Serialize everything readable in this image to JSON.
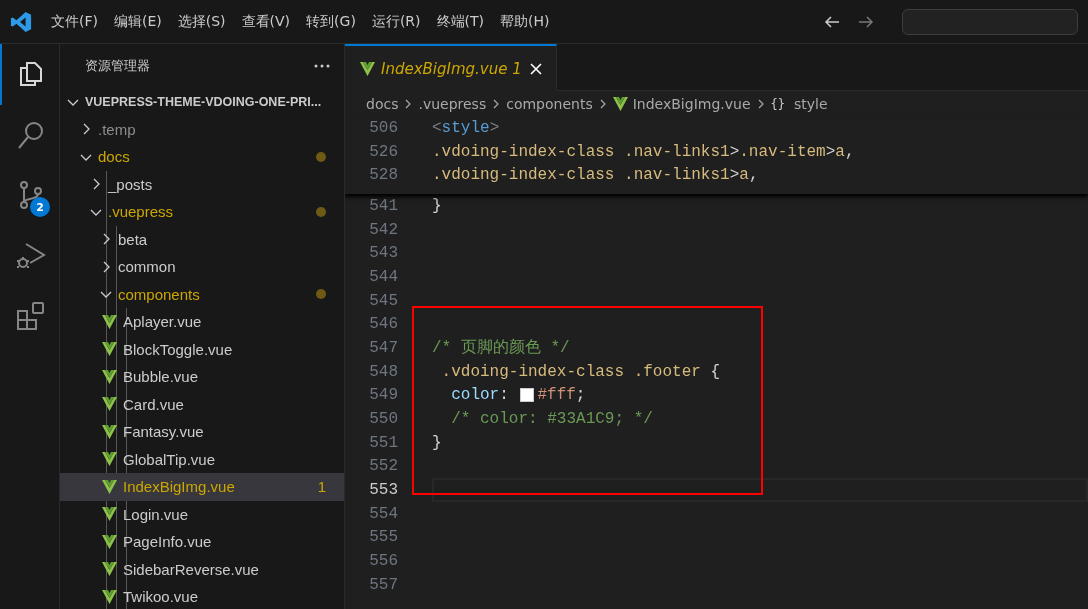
{
  "title_bar": {
    "menu": [
      "文件(F)",
      "编辑(E)",
      "选择(S)",
      "查看(V)",
      "转到(G)",
      "运行(R)",
      "终端(T)",
      "帮助(H)"
    ]
  },
  "activity_bar": [
    {
      "kind": "explorer",
      "selected": true
    },
    {
      "kind": "search",
      "selected": false
    },
    {
      "kind": "source-control",
      "selected": false,
      "badge": "2"
    },
    {
      "kind": "run-debug",
      "selected": false
    },
    {
      "kind": "extensions",
      "selected": false
    }
  ],
  "sidebar": {
    "title": "资源管理器",
    "root": {
      "label": "VUEPRESS-THEME-VDOING-ONE-PRI...",
      "expanded": true,
      "children": [
        {
          "label": ".temp",
          "kind": "folder",
          "expanded": false,
          "ignored": true,
          "modified": false,
          "selected": false
        },
        {
          "label": "docs",
          "kind": "folder",
          "expanded": true,
          "ignored": false,
          "modified": true,
          "selected": false,
          "children": [
            {
              "label": "_posts",
              "kind": "folder",
              "expanded": false,
              "ignored": false,
              "modified": false,
              "selected": false
            },
            {
              "label": ".vuepress",
              "kind": "folder",
              "expanded": true,
              "ignored": false,
              "modified": true,
              "selected": false,
              "children": [
                {
                  "label": "beta",
                  "kind": "folder",
                  "expanded": false,
                  "ignored": false,
                  "modified": false,
                  "selected": false
                },
                {
                  "label": "common",
                  "kind": "folder",
                  "expanded": false,
                  "ignored": false,
                  "modified": false,
                  "selected": false
                },
                {
                  "label": "components",
                  "kind": "folder",
                  "expanded": true,
                  "ignored": false,
                  "modified": true,
                  "selected": false,
                  "children": [
                    {
                      "label": "Aplayer.vue",
                      "kind": "vue",
                      "ignored": false,
                      "modified": false,
                      "selected": false
                    },
                    {
                      "label": "BlockToggle.vue",
                      "kind": "vue",
                      "ignored": false,
                      "modified": false,
                      "selected": false
                    },
                    {
                      "label": "Bubble.vue",
                      "kind": "vue",
                      "ignored": false,
                      "modified": false,
                      "selected": false
                    },
                    {
                      "label": "Card.vue",
                      "kind": "vue",
                      "ignored": false,
                      "modified": false,
                      "selected": false
                    },
                    {
                      "label": "Fantasy.vue",
                      "kind": "vue",
                      "ignored": false,
                      "modified": false,
                      "selected": false
                    },
                    {
                      "label": "GlobalTip.vue",
                      "kind": "vue",
                      "ignored": false,
                      "modified": false,
                      "selected": false
                    },
                    {
                      "label": "IndexBigImg.vue",
                      "kind": "vue",
                      "ignored": false,
                      "modified": true,
                      "selected": true,
                      "problems": "1"
                    },
                    {
                      "label": "Login.vue",
                      "kind": "vue",
                      "ignored": false,
                      "modified": false,
                      "selected": false
                    },
                    {
                      "label": "PageInfo.vue",
                      "kind": "vue",
                      "ignored": false,
                      "modified": false,
                      "selected": false
                    },
                    {
                      "label": "SidebarReverse.vue",
                      "kind": "vue",
                      "ignored": false,
                      "modified": false,
                      "selected": false
                    },
                    {
                      "label": "Twikoo.vue",
                      "kind": "vue",
                      "ignored": false,
                      "modified": false,
                      "selected": false
                    }
                  ]
                }
              ]
            }
          ]
        }
      ]
    }
  },
  "tabs": [
    {
      "label": "IndexBigImg.vue",
      "problems": "1",
      "selected": true,
      "preview": true
    }
  ],
  "breadcrumbs": [
    {
      "label": "docs",
      "kind": "folder"
    },
    {
      "label": ".vuepress",
      "kind": "folder"
    },
    {
      "label": "components",
      "kind": "folder"
    },
    {
      "label": "IndexBigImg.vue",
      "kind": "vue"
    },
    {
      "label": "style",
      "kind": "symbol",
      "icon": "{}"
    }
  ],
  "sticky_lines": [
    {
      "number": "506",
      "tokens": [
        {
          "kind": "punct",
          "text": "<"
        },
        {
          "kind": "tag",
          "text": "style"
        },
        {
          "kind": "punct",
          "text": ">"
        }
      ]
    },
    {
      "number": "526",
      "tokens": [
        {
          "kind": "selector",
          "text": ".vdoing-index-class .nav-links1"
        },
        {
          "kind": "plain",
          "text": ">"
        },
        {
          "kind": "selector",
          "text": ".nav-item"
        },
        {
          "kind": "plain",
          "text": ">"
        },
        {
          "kind": "selector",
          "text": "a"
        },
        {
          "kind": "plain",
          "text": ","
        }
      ]
    },
    {
      "number": "528",
      "tokens": [
        {
          "kind": "selector",
          "text": ".vdoing-index-class .nav-links1"
        },
        {
          "kind": "plain",
          "text": ">"
        },
        {
          "kind": "selector",
          "text": "a"
        },
        {
          "kind": "plain",
          "text": ","
        }
      ]
    }
  ],
  "lines": [
    {
      "number": "541",
      "current": false,
      "tokens": [
        {
          "kind": "plain",
          "text": "}"
        }
      ]
    },
    {
      "number": "542",
      "current": false
    },
    {
      "number": "543",
      "current": false
    },
    {
      "number": "544",
      "current": false
    },
    {
      "number": "545",
      "current": false
    },
    {
      "number": "546",
      "current": false
    },
    {
      "number": "547",
      "current": false,
      "tokens": [
        {
          "kind": "comment",
          "text": "/* 页脚的颜色 */"
        }
      ]
    },
    {
      "number": "548",
      "current": false,
      "tokens": [
        {
          "kind": "selector",
          "text": " .vdoing-index-class .footer "
        },
        {
          "kind": "plain",
          "text": "{"
        }
      ]
    },
    {
      "number": "549",
      "current": false,
      "tokens": [
        {
          "kind": "property",
          "text": "  color"
        },
        {
          "kind": "plain",
          "text": ": "
        },
        {
          "kind": "swatch",
          "color": "#ffffff"
        },
        {
          "kind": "value",
          "text": "#fff"
        },
        {
          "kind": "plain",
          "text": ";"
        }
      ]
    },
    {
      "number": "550",
      "current": false,
      "tokens": [
        {
          "kind": "comment",
          "text": "  /* color: #33A1C9; */"
        }
      ]
    },
    {
      "number": "551",
      "current": false,
      "tokens": [
        {
          "kind": "plain",
          "text": "}"
        }
      ]
    },
    {
      "number": "552",
      "current": false
    },
    {
      "number": "553",
      "current": true
    },
    {
      "number": "554",
      "current": false
    },
    {
      "number": "555",
      "current": false
    },
    {
      "number": "556",
      "current": false
    },
    {
      "number": "557",
      "current": false
    }
  ],
  "annotation": {
    "kind": "highlight-box",
    "color": "#ff0000"
  }
}
